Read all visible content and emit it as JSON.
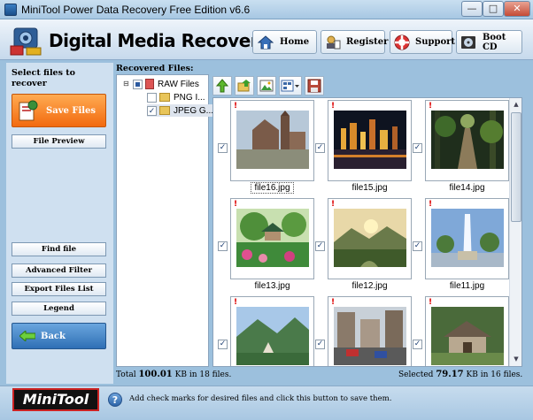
{
  "window": {
    "title": "MiniTool Power Data Recovery Free Edition v6.6",
    "min": "—",
    "max": "□",
    "close": "✕"
  },
  "header": {
    "logo_text": "Digital Media Recovery",
    "buttons": {
      "home": "Home",
      "register": "Register",
      "support": "Support",
      "boot_cd": "Boot CD"
    }
  },
  "left": {
    "heading": "Select files to recover",
    "save_files": "Save Files",
    "file_preview": "File Preview",
    "find_file": "Find file",
    "advanced_filter": "Advanced Filter",
    "export_files_list": "Export Files List",
    "legend": "Legend",
    "back": "Back"
  },
  "main": {
    "recovered_label": "Recovered Files:",
    "tree": [
      {
        "label": "RAW Files",
        "toggle": "⊟",
        "check": "partial"
      },
      {
        "label": "PNG I...",
        "check": "unchecked"
      },
      {
        "label": "JPEG G...",
        "check": "checked"
      }
    ],
    "files": [
      {
        "name": "file16.jpg",
        "scene": "church"
      },
      {
        "name": "file15.jpg",
        "scene": "city-night"
      },
      {
        "name": "file14.jpg",
        "scene": "forest-path"
      },
      {
        "name": "file13.jpg",
        "scene": "garden-pavilion"
      },
      {
        "name": "file12.jpg",
        "scene": "valley-sunset"
      },
      {
        "name": "file11.jpg",
        "scene": "fountain"
      },
      {
        "name": "",
        "scene": "mountain-temple"
      },
      {
        "name": "",
        "scene": "street"
      },
      {
        "name": "",
        "scene": "cottage"
      }
    ],
    "totals": {
      "prefix": "Total",
      "size": "100.01",
      "suffix": "KB in 18 files."
    },
    "selected": {
      "prefix": "Selected",
      "size": "79.17",
      "suffix": "KB in 16 files."
    }
  },
  "footer": {
    "brand": "MiniTool",
    "hint": "Add check marks for desired files and click this button to save them."
  },
  "colors": {
    "accent_orange": "#f26a0f",
    "back_blue": "#2f6fb5",
    "pane_blue": "#cfe0f0"
  }
}
